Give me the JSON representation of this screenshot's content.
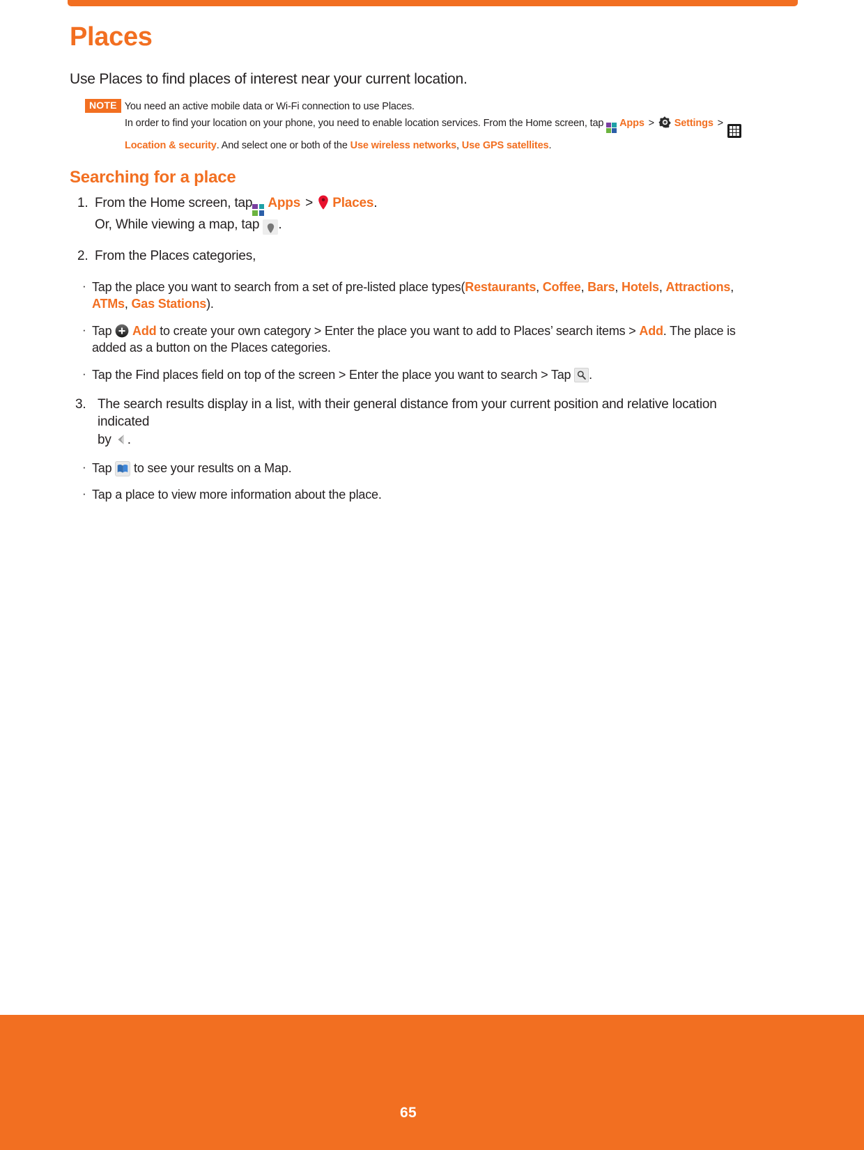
{
  "theme": {
    "accent": "#f26f21",
    "text": "#231f20",
    "page_bg": "#ffffff"
  },
  "header": {
    "title": "Places"
  },
  "intro": {
    "text": "Use Places to find places of interest near your current location."
  },
  "note": {
    "badge": "NOTE",
    "line1": "You need an active mobile data or Wi-Fi connection to use Places.",
    "line2_a": "In order to find your location on your phone, you need to enable location services. From the Home screen, tap",
    "line2_apps": "Apps",
    "line2_gt1": ">",
    "line2_settings": "Settings",
    "line2_gt2": ">",
    "line3_location": "Location & security",
    "line3_mid": ". And select one or both of the ",
    "line3_wireless": "Use wireless networks",
    "line3_comma": ", ",
    "line3_gps": "Use GPS satellites",
    "line3_end": ".",
    "icons": {
      "apps": "apps-grid-icon",
      "settings": "gear-icon",
      "all_apps": "app-drawer-icon"
    }
  },
  "section": {
    "title": "Searching for a place"
  },
  "steps": [
    {
      "num": "1.",
      "text_a": "From the Home screen, tap",
      "apps_label": "Apps",
      "gt": ">",
      "places_label": "Places",
      "period": ".",
      "sub_a": "Or, While viewing a map, tap",
      "sub_b": ".",
      "icons": {
        "apps": "apps-grid-icon",
        "places": "map-pin-red-icon",
        "map_pin": "map-pin-gray-icon"
      }
    },
    {
      "num": "2.",
      "text": "From the Places categories,"
    },
    {
      "num": "3.",
      "text_a": "The search results display in a list, with their general distance from your current position and relative location indicated",
      "text_b": "by",
      "text_c": ".",
      "icons": {
        "direction": "direction-arrow-icon"
      }
    }
  ],
  "bullets_group1": [
    {
      "dot": "·",
      "prefix": "Tap the place you want to search from a set of pre-listed place types(",
      "types": [
        "Restaurants",
        "Coffee",
        "Bars",
        "Hotels",
        "Attractions",
        "ATMs",
        "Gas Stations"
      ],
      "suffix": ")."
    },
    {
      "dot": "·",
      "t1": "Tap",
      "add1": "Add",
      "t2": "to create your own category > Enter the place you want to add to Places’ search items >",
      "add2": "Add",
      "t3": ". The place is added as a button on the Places categories.",
      "icons": {
        "add": "plus-circle-icon"
      }
    },
    {
      "dot": "·",
      "t1": "Tap the Find places field on top of the screen > Enter the place you want to search > Tap",
      "t2": ".",
      "icons": {
        "search": "search-icon"
      }
    }
  ],
  "bullets_group2": [
    {
      "dot": "·",
      "t1": "Tap",
      "t2": "to see your results on a Map.",
      "icons": {
        "map": "map-book-icon"
      }
    },
    {
      "dot": "·",
      "t1": "Tap a place to view more information about the place."
    }
  ],
  "footer": {
    "page_number": "65"
  }
}
